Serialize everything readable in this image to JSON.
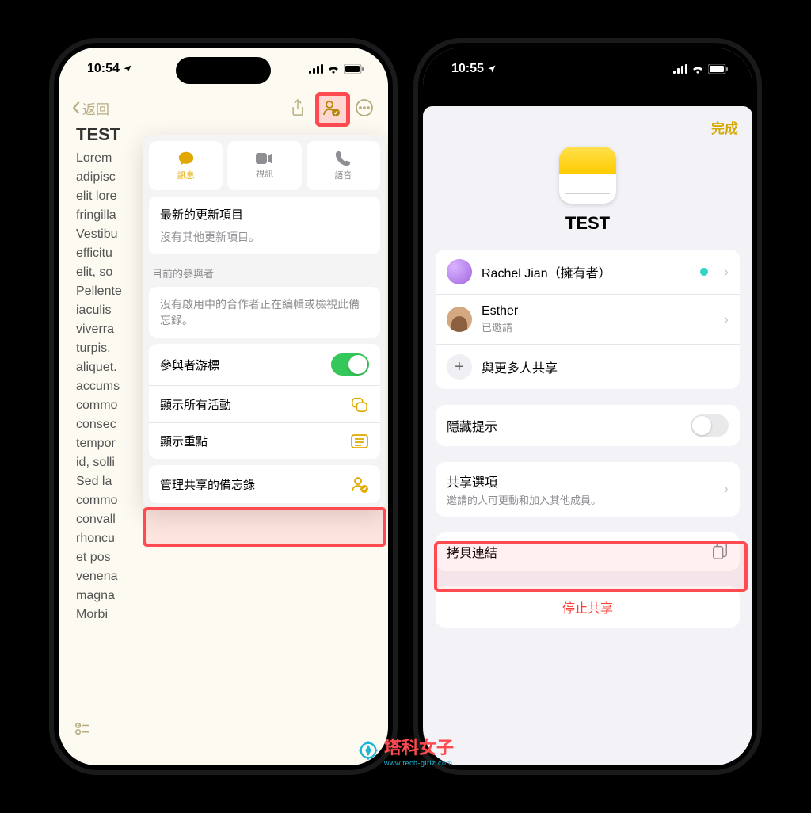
{
  "left": {
    "status_time": "10:54",
    "nav_back": "返回",
    "note_title": "TEST",
    "note_body_lines": [
      "Lorem",
      "adipisc",
      "elit lore",
      "fringilla",
      "Vestibu",
      "efficitu",
      "elit, so",
      "Pellente",
      "iaculis",
      "viverra",
      "turpis.",
      "aliquet.",
      "accums",
      "commo",
      "consec",
      "tempor",
      "id, solli",
      "Sed la",
      "commo",
      "convall",
      "rhoncu",
      "et pos",
      "venena",
      "magna",
      "Morbi"
    ],
    "seg": {
      "msg": "訊息",
      "video": "視訊",
      "voice": "語音"
    },
    "updates": {
      "title": "最新的更新項目",
      "sub": "沒有其他更新項目。"
    },
    "participants_label": "目前的參與者",
    "participants_empty": "沒有啟用中的合作者正在編輯或檢視此備忘錄。",
    "rows": {
      "cursor": "參與者游標",
      "activity": "顯示所有活動",
      "highlights": "顯示重點",
      "manage": "管理共享的備忘錄"
    }
  },
  "right": {
    "status_time": "10:55",
    "done": "完成",
    "title": "TEST",
    "people": {
      "owner": "Rachel Jian（擁有者）",
      "guest_name": "Esther",
      "guest_status": "已邀請",
      "add_more": "與更多人共享"
    },
    "hide_hints": "隱藏提示",
    "share_options": {
      "title": "共享選項",
      "sub": "邀請的人可更動和加入其他成員。"
    },
    "copy_link": "拷貝連結",
    "stop_share": "停止共享"
  },
  "watermark": {
    "text": "塔科女子",
    "url": "www.tech-girlz.com"
  }
}
